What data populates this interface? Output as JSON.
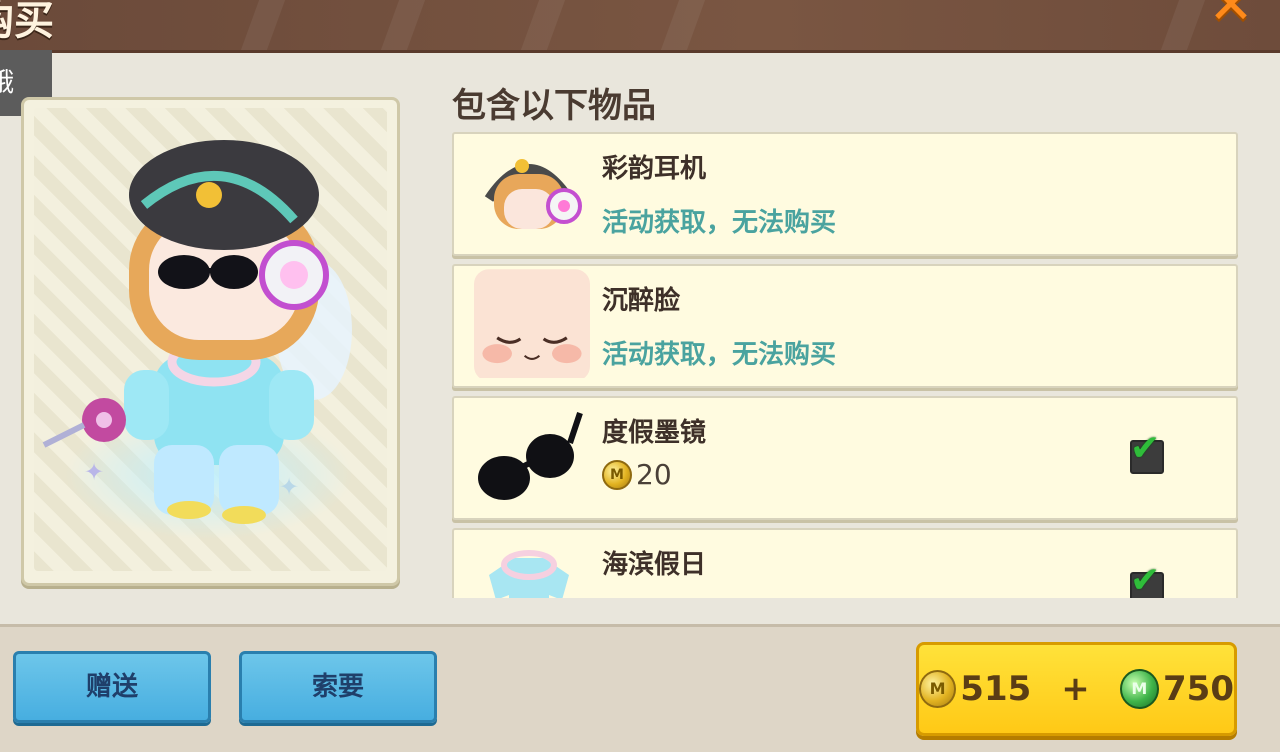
{
  "header": {
    "title": "购买",
    "close_icon": "close-icon"
  },
  "tooltip": {
    "text": "哦"
  },
  "section": {
    "title": "包含以下物品"
  },
  "items": [
    {
      "name": "彩韵耳机",
      "status": "活动获取，无法购买",
      "icon": "headphones-icon"
    },
    {
      "name": "沉醉脸",
      "status": "活动获取，无法购买",
      "icon": "face-icon"
    },
    {
      "name": "度假墨镜",
      "price": "20",
      "currency_icon": "coin-icon",
      "checked": true,
      "icon": "sunglasses-icon"
    },
    {
      "name": "海滨假日",
      "checked": true,
      "icon": "shirt-icon"
    }
  ],
  "footer": {
    "gift_label": "赠送",
    "request_label": "索要",
    "buy": {
      "coin_amount": "515",
      "plus": "+",
      "gem_amount": "750",
      "coin_icon": "coin-icon",
      "gem_icon": "gem-icon"
    }
  },
  "colors": {
    "header_bg": "#6b4a3a",
    "accent_orange": "#ff8a1a",
    "status_teal": "#4aa39f",
    "button_blue": "#47aee0",
    "buy_yellow": "#ffc916"
  }
}
